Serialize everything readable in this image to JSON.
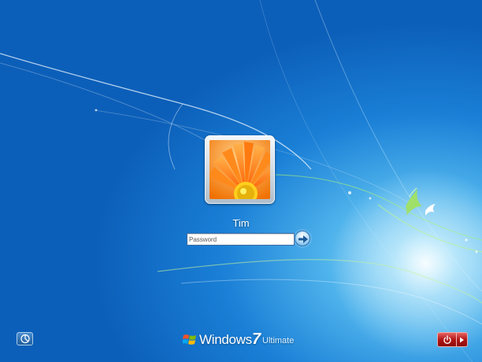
{
  "login": {
    "username": "Tim",
    "password_placeholder": "Password",
    "password_value": ""
  },
  "branding": {
    "word": "Windows",
    "version": "7",
    "edition": "Ultimate"
  },
  "icons": {
    "submit": "arrow-right-icon",
    "ease_of_access": "ease-of-access-icon",
    "power": "power-icon",
    "power_options": "triangle-right-icon",
    "logo": "windows-flag-icon"
  },
  "colors": {
    "background_blue": "#1a7fd6",
    "glow_cyan": "#a8e4fb",
    "power_red": "#b11616",
    "bird_green": "#9fe06a"
  }
}
